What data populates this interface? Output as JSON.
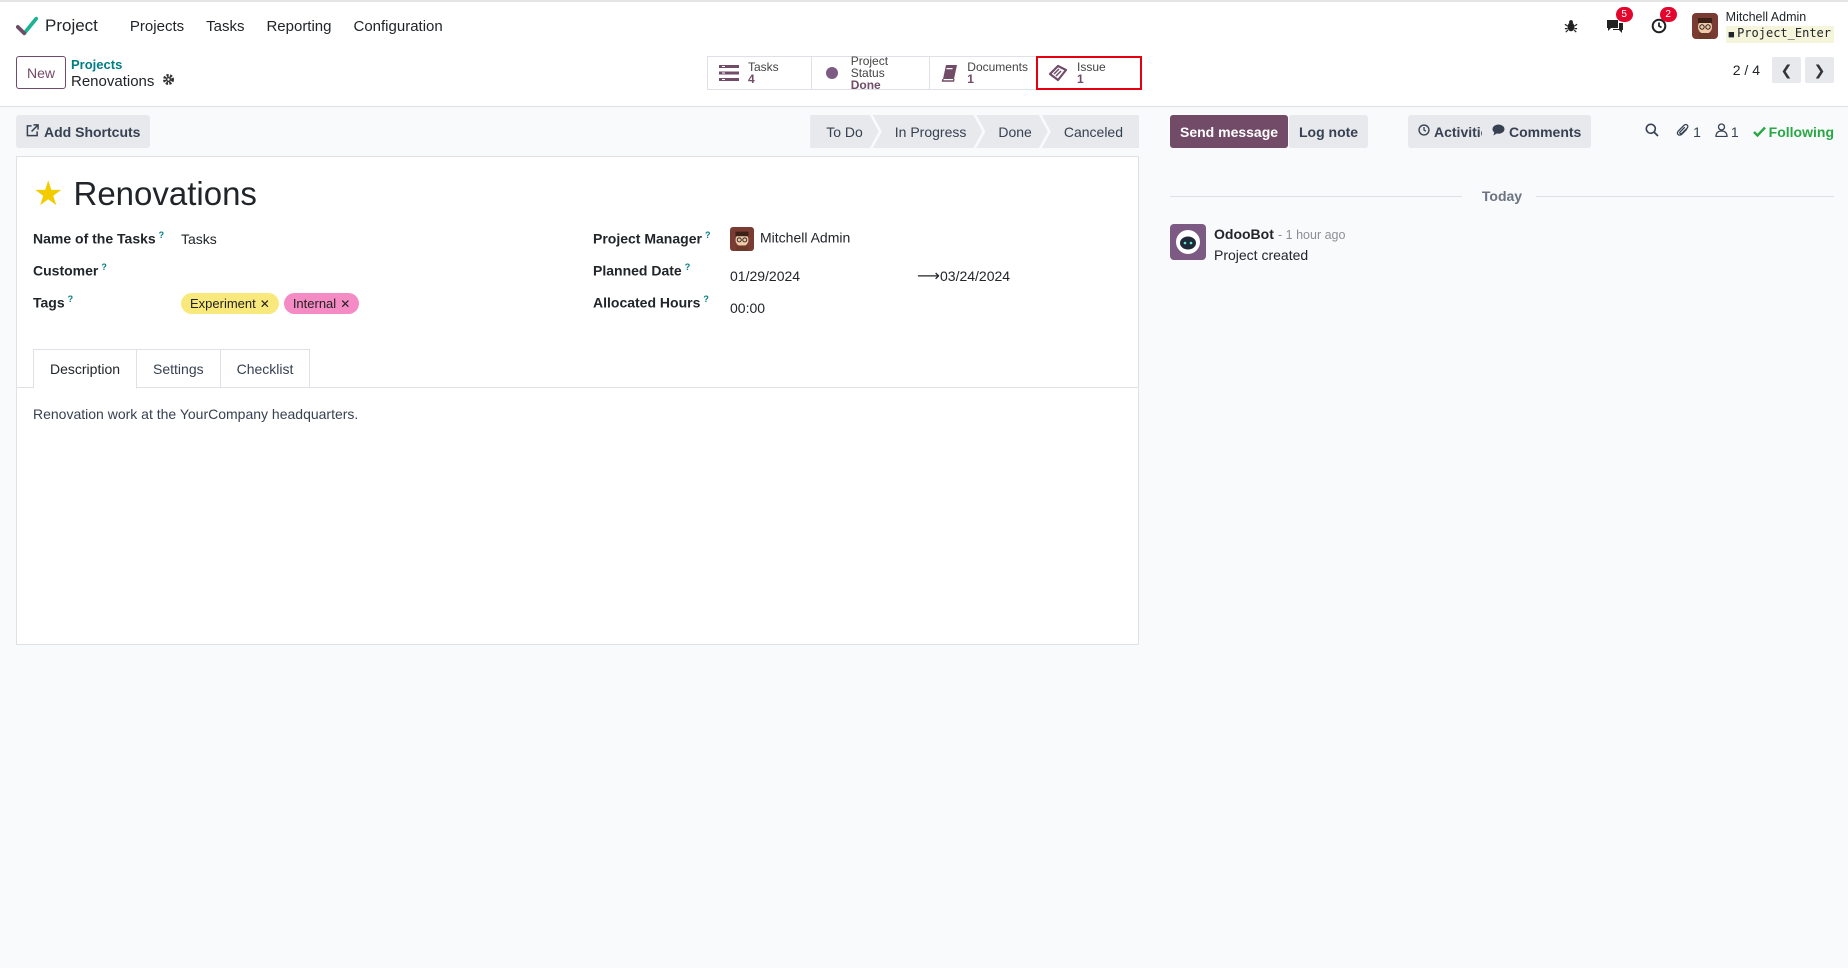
{
  "navbar": {
    "app_name": "Project",
    "menu": [
      "Projects",
      "Tasks",
      "Reporting",
      "Configuration"
    ],
    "messages_count": "5",
    "activities_count": "2",
    "user_name": "Mitchell Admin",
    "database": "Project_Enter"
  },
  "control_panel": {
    "new_label": "New",
    "breadcrumb_parent": "Projects",
    "breadcrumb_current": "Renovations",
    "smart_buttons": [
      {
        "label": "Tasks",
        "value": "4",
        "icon": "tasks-icon"
      },
      {
        "label": "Project Status",
        "value": "Done",
        "icon": "status-dot-icon"
      },
      {
        "label": "Documents",
        "value": "1",
        "icon": "book-icon"
      },
      {
        "label": "Issue",
        "value": "1",
        "icon": "ticket-icon"
      }
    ],
    "pager": "2 / 4"
  },
  "status_bar": {
    "shortcuts_label": "Add Shortcuts",
    "stages": [
      "To Do",
      "In Progress",
      "Done",
      "Canceled"
    ]
  },
  "form": {
    "title": "Renovations",
    "name_of_tasks_label": "Name of the Tasks",
    "name_of_tasks_value": "Tasks",
    "customer_label": "Customer",
    "customer_value": "",
    "tags_label": "Tags",
    "tags": [
      "Experiment",
      "Internal"
    ],
    "project_manager_label": "Project Manager",
    "project_manager_value": "Mitchell Admin",
    "planned_date_label": "Planned Date",
    "planned_date_start": "01/29/2024",
    "planned_date_end": "03/24/2024",
    "allocated_hours_label": "Allocated Hours",
    "allocated_hours_value": "00:00",
    "help_mark": "?",
    "tabs": [
      "Description",
      "Settings",
      "Checklist"
    ],
    "description": "Renovation work at the YourCompany headquarters."
  },
  "chatter": {
    "send_message": "Send message",
    "log_note": "Log note",
    "activities": "Activities",
    "comments": "Comments",
    "attachments_count": "1",
    "followers_count": "1",
    "following": "Following",
    "separator": "Today",
    "messages": [
      {
        "author": "OdooBot",
        "time": "- 1 hour ago",
        "text": "Project created"
      }
    ]
  },
  "colors": {
    "brand": "#714b67",
    "link": "#017e84",
    "badge": "#e4062d",
    "following": "#28a745",
    "star": "#f3cc00",
    "highlight": "#e4000f"
  }
}
